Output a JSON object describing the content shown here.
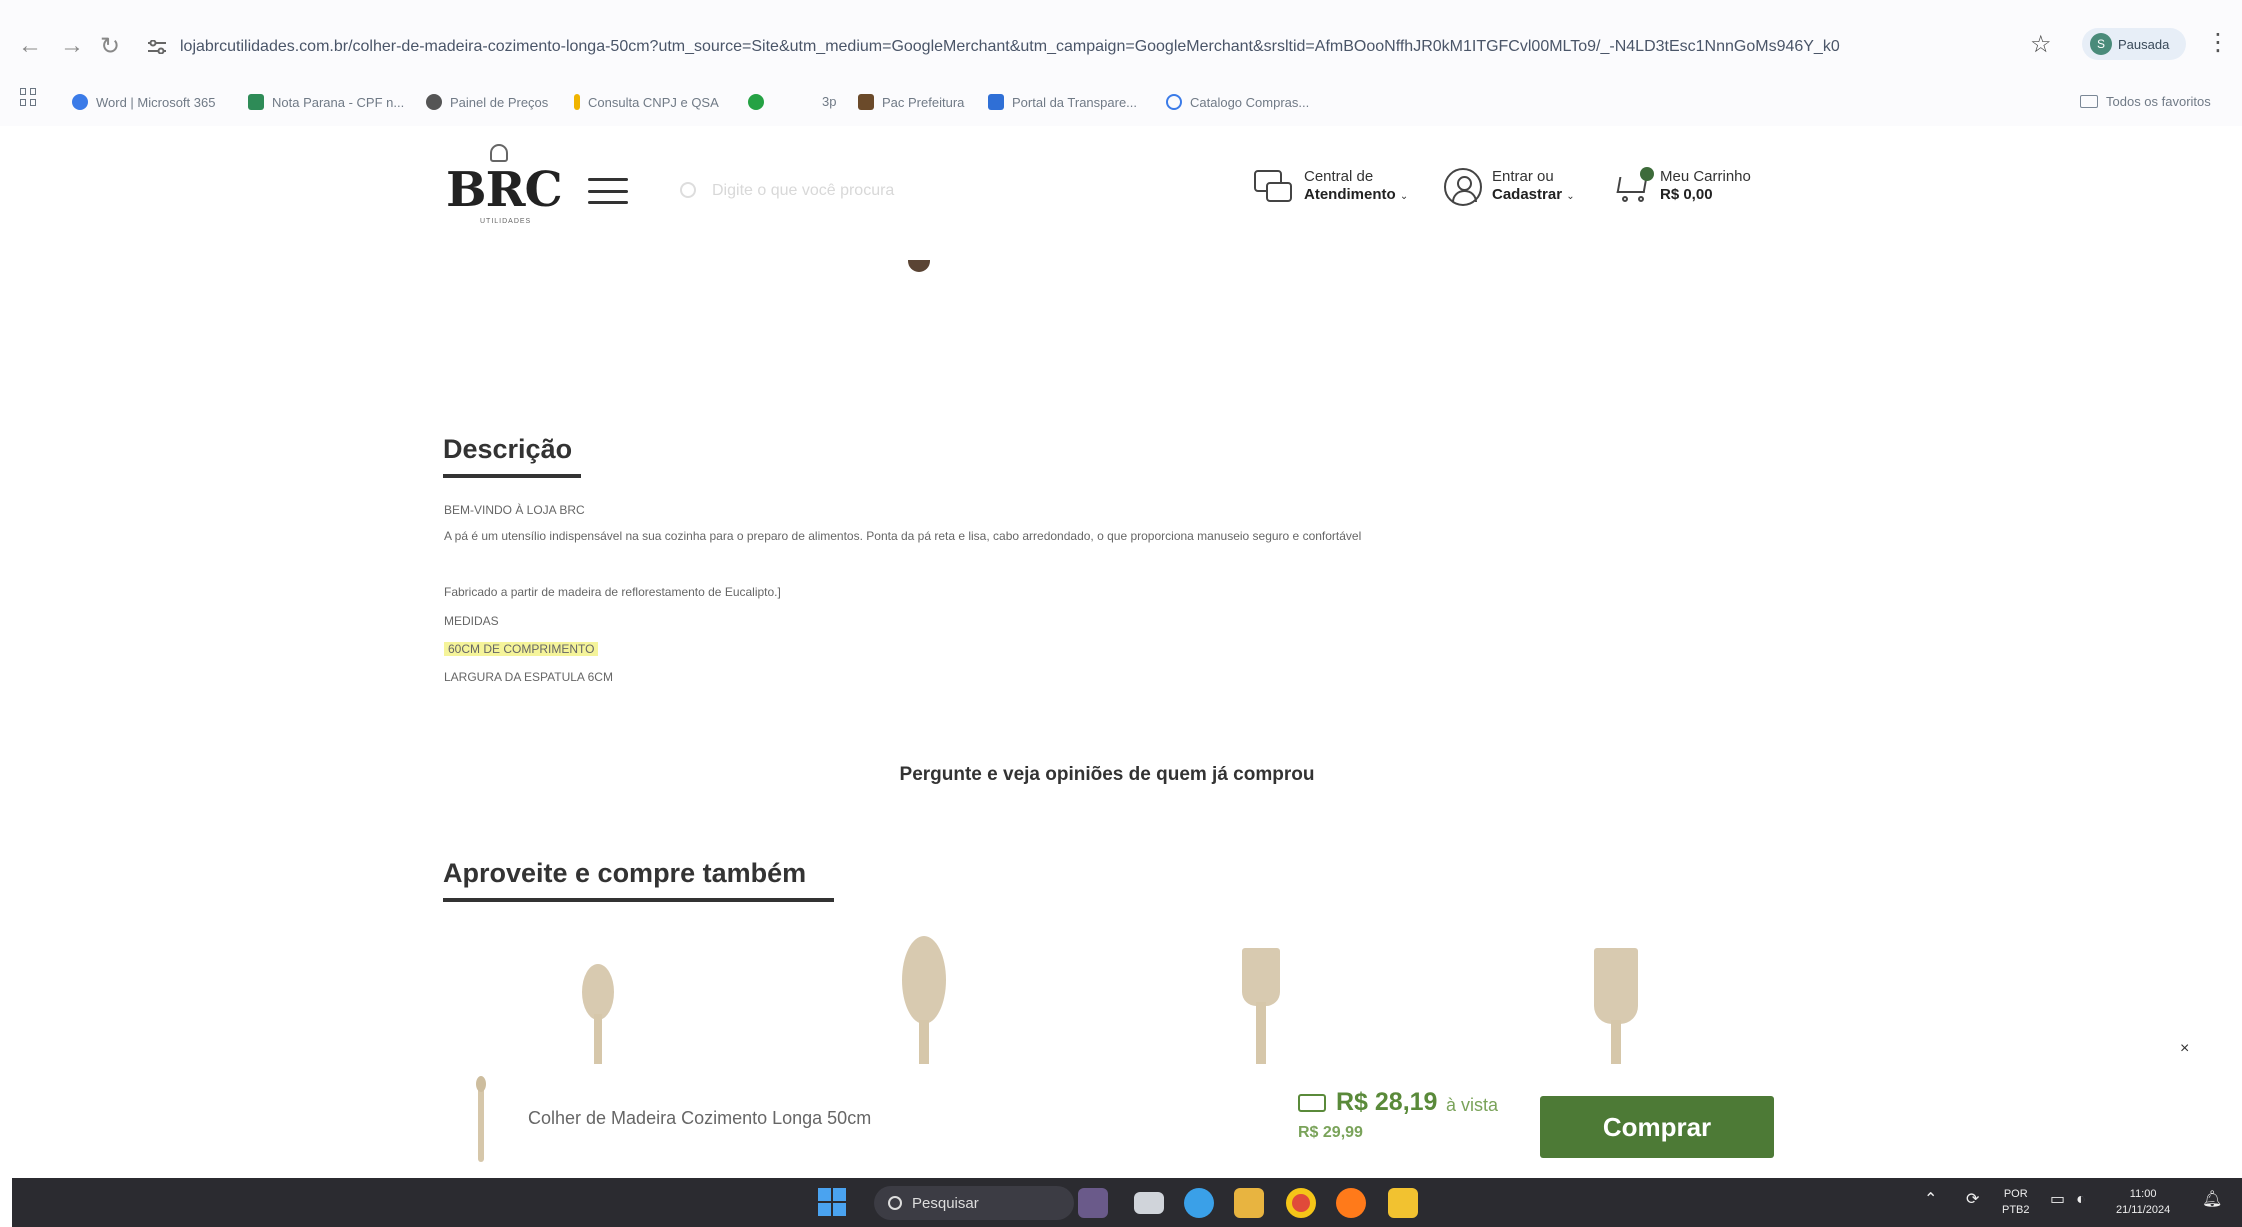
{
  "browser": {
    "url": "lojabrcutilidades.com.br/colher-de-madeira-cozimento-longa-50cm?utm_source=Site&utm_medium=GoogleMerchant&utm_campaign=GoogleMerchant&srsltid=AfmBOooNffhJR0kM1ITGFCvl00MLTo9/_-N4LD3tEsc1NnnGoMs946Y_k0",
    "profile_initial": "S",
    "profile_label": "Pausada",
    "bookmarks": [
      "Word | Microsoft 365",
      "Nota Parana - CPF n...",
      "Painel de Preços",
      "Consulta CNPJ e QSA",
      "3p",
      "Pac Prefeitura",
      "Portal da Transpare...",
      "Catalogo Compras..."
    ],
    "all_favorites": "Todos os favoritos"
  },
  "header": {
    "logo": "BRC",
    "logo_sub": "UTILIDADES",
    "search_placeholder": "Digite o que você procura",
    "support": {
      "line1": "Central de",
      "line2": "Atendimento"
    },
    "account": {
      "line1": "Entrar ou",
      "line2": "Cadastrar"
    },
    "cart": {
      "line1": "Meu Carrinho",
      "line2": "R$ 0,00"
    }
  },
  "description": {
    "title": "Descrição",
    "lines": [
      "BEM-VINDO À LOJA BRC",
      "A pá é um utensílio indispensável na sua cozinha para o preparo de alimentos. Ponta da pá reta e lisa, cabo arredondado, o que proporciona manuseio seguro e confortável",
      "Fabricado a partir de madeira de reflorestamento de Eucalipto.]",
      "MEDIDAS",
      "60CM DE COMPRIMENTO",
      "LARGURA DA ESPATULA 6CM"
    ]
  },
  "questions_link": "Pergunte e veja opiniões de quem já comprou",
  "related": {
    "title": "Aproveite e compre também"
  },
  "sticky_bar": {
    "product_name": "Colher de Madeira Cozimento Longa 50cm",
    "price": "R$ 28,19",
    "price_suffix": "à vista",
    "price_old": "R$ 29,99",
    "buy_label": "Comprar",
    "close": "×"
  },
  "taskbar": {
    "search_label": "Pesquisar",
    "lang_line1": "POR",
    "lang_line2": "PTB2",
    "time": "11:00",
    "date": "21/11/2024"
  },
  "colors": {
    "accent_green": "#4d7a36",
    "price_green": "#5a8a3a",
    "highlight": "#f5f49a"
  }
}
